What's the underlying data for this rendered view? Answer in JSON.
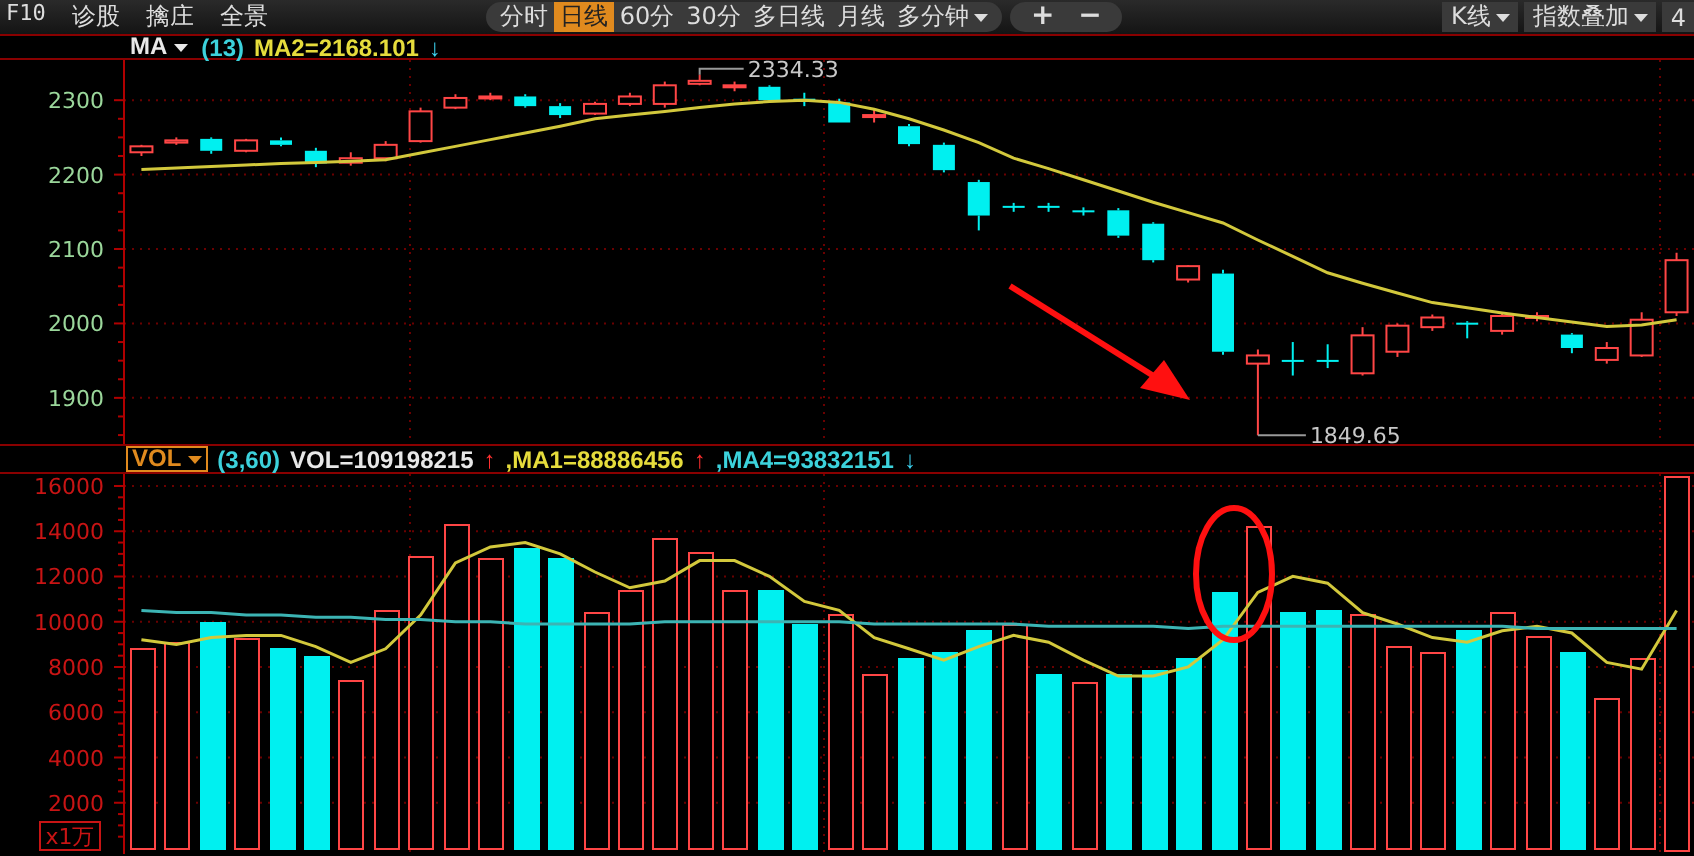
{
  "toolbar": {
    "left_menu": [
      "F10",
      "诊股",
      "擒庄",
      "全景"
    ],
    "period_tabs": [
      {
        "label": "分时",
        "selected": false,
        "dropdown": false
      },
      {
        "label": "日线",
        "selected": true,
        "dropdown": false
      },
      {
        "label": "60分",
        "selected": false,
        "dropdown": false
      },
      {
        "label": "30分",
        "selected": false,
        "dropdown": false
      },
      {
        "label": "多日线",
        "selected": false,
        "dropdown": false
      },
      {
        "label": "月线",
        "selected": false,
        "dropdown": false
      },
      {
        "label": "多分钟",
        "selected": false,
        "dropdown": true
      }
    ],
    "zoom_buttons": [
      "+",
      "−"
    ],
    "right_buttons": [
      {
        "label": "K线",
        "dropdown": true
      },
      {
        "label": "指数叠加",
        "dropdown": true
      },
      {
        "label": "4",
        "dropdown": false
      }
    ]
  },
  "price_panel": {
    "header": {
      "indicator": "MA",
      "items": [
        {
          "kind": "param",
          "text": "(13)"
        },
        {
          "kind": "value",
          "text": "MA2=2168.101",
          "color": "#e6dc3c"
        },
        {
          "kind": "down",
          "text": "↓"
        }
      ]
    },
    "chart_data": {
      "type": "line",
      "ylim": [
        1838,
        2354
      ],
      "yticks": [
        1900,
        2000,
        2100,
        2200,
        2300
      ],
      "grid": true,
      "series": [
        {
          "type": "candlestick",
          "ohlc": [
            [
              2230,
              2240,
              2225,
              2238
            ],
            [
              2243,
              2250,
              2240,
              2246
            ],
            [
              2248,
              2250,
              2228,
              2232
            ],
            [
              2232,
              2248,
              2230,
              2246
            ],
            [
              2246,
              2250,
              2238,
              2240
            ],
            [
              2232,
              2236,
              2210,
              2215
            ],
            [
              2216,
              2230,
              2212,
              2222
            ],
            [
              2222,
              2245,
              2218,
              2240
            ],
            [
              2245,
              2290,
              2243,
              2285
            ],
            [
              2290,
              2308,
              2288,
              2303
            ],
            [
              2303,
              2310,
              2300,
              2305
            ],
            [
              2305,
              2308,
              2290,
              2292
            ],
            [
              2292,
              2296,
              2276,
              2280
            ],
            [
              2282,
              2298,
              2280,
              2295
            ],
            [
              2295,
              2310,
              2292,
              2305
            ],
            [
              2295,
              2325,
              2290,
              2320
            ],
            [
              2322,
              2334.33,
              2320,
              2326
            ],
            [
              2318,
              2325,
              2312,
              2320
            ],
            [
              2318,
              2320,
              2298,
              2300
            ],
            [
              2302,
              2310,
              2292,
              2300
            ],
            [
              2297,
              2302,
              2270,
              2270
            ],
            [
              2278,
              2288,
              2270,
              2280
            ],
            [
              2265,
              2268,
              2238,
              2241
            ],
            [
              2240,
              2243,
              2203,
              2206
            ],
            [
              2190,
              2193,
              2125,
              2145
            ],
            [
              2158,
              2162,
              2150,
              2158
            ],
            [
              2158,
              2162,
              2150,
              2158
            ],
            [
              2152,
              2156,
              2145,
              2152
            ],
            [
              2152,
              2155,
              2115,
              2118
            ],
            [
              2134,
              2136,
              2082,
              2085
            ],
            [
              2059,
              2078,
              2055,
              2077
            ],
            [
              2067,
              2072,
              1958,
              1962
            ],
            [
              1946,
              1965,
              1849.65,
              1957
            ],
            [
              1951,
              1975,
              1930,
              1951
            ],
            [
              1951,
              1972,
              1940,
              1951
            ],
            [
              1933,
              1995,
              1930,
              1984
            ],
            [
              1962,
              2000,
              1955,
              1997
            ],
            [
              1995,
              2012,
              1990,
              2008
            ],
            [
              2001,
              2003,
              1980,
              2000
            ],
            [
              1990,
              2015,
              1985,
              2010
            ],
            [
              2008,
              2015,
              2003,
              2010
            ],
            [
              1985,
              1987,
              1960,
              1967
            ],
            [
              1951,
              1975,
              1946,
              1967
            ],
            [
              1957,
              2015,
              1955,
              2005
            ],
            [
              2015,
              2095,
              2010,
              2085
            ]
          ]
        },
        {
          "type": "line",
          "color": "#d2c83c",
          "values": [
            2207,
            2209,
            2211,
            2213,
            2215,
            2216,
            2218,
            2220,
            2229,
            2238,
            2247,
            2256,
            2265,
            2275,
            2280,
            2285,
            2290,
            2295,
            2298,
            2300,
            2297,
            2288,
            2275,
            2260,
            2243,
            2222,
            2208,
            2193,
            2178,
            2163,
            2149,
            2135,
            2112,
            2090,
            2068,
            2054,
            2041,
            2028,
            2021,
            2014,
            2008,
            2002,
            1996,
            1998,
            2005
          ]
        }
      ],
      "annotations": [
        "2334.33",
        "1849.65"
      ]
    }
  },
  "volume_panel": {
    "header": {
      "indicator": "VOL",
      "items": [
        {
          "kind": "param",
          "text": "(3,60)"
        },
        {
          "kind": "value",
          "text": "VOL=109198215",
          "color": "#e8e8e8"
        },
        {
          "kind": "up",
          "text": "↑"
        },
        {
          "kind": "value",
          "text": ",MA1=88886456",
          "color": "#e6dc3c"
        },
        {
          "kind": "up",
          "text": "↑"
        },
        {
          "kind": "value",
          "text": ",MA4=93832151",
          "color": "#3cd2dc"
        },
        {
          "kind": "down",
          "text": "↓"
        }
      ]
    },
    "chart_data": {
      "type": "bar",
      "ylim": [
        -265,
        16530
      ],
      "yticks": [
        2000,
        4000,
        6000,
        8000,
        10000,
        12000,
        14000,
        16000
      ],
      "ylabel": "x1万",
      "grid": true,
      "series": [
        {
          "type": "bar",
          "colors": [
            "#ff4646",
            "#ff4646",
            "#00f0f0",
            "#ff4646",
            "#00f0f0",
            "#00f0f0",
            "#ff4646",
            "#ff4646",
            "#ff4646",
            "#ff4646",
            "#ff4646",
            "#00f0f0",
            "#00f0f0",
            "#ff4646",
            "#ff4646",
            "#ff4646",
            "#ff4646",
            "#ff4646",
            "#00f0f0",
            "#00f0f0",
            "#ff4646",
            "#ff4646",
            "#00f0f0",
            "#00f0f0",
            "#00f0f0",
            "#ff4646",
            "#00f0f0",
            "#ff4646",
            "#00f0f0",
            "#00f0f0",
            "#00f0f0",
            "#00f0f0",
            "#ff4646",
            "#00f0f0",
            "#00f0f0",
            "#ff4646",
            "#ff4646",
            "#ff4646",
            "#00f0f0",
            "#ff4646",
            "#ff4646",
            "#00f0f0",
            "#ff4646",
            "#ff4646",
            "#ff4646"
          ],
          "values": [
            8800,
            9100,
            10000,
            9300,
            8800,
            8500,
            7400,
            10500,
            12900,
            14300,
            12800,
            13300,
            12800,
            10400,
            11400,
            13700,
            13100,
            11400,
            11400,
            9900,
            10300,
            7700,
            8400,
            8700,
            9600,
            9900,
            7700,
            7300,
            7700,
            7900,
            8400,
            11300,
            14200,
            10400,
            10500,
            10300,
            8900,
            8700,
            9600,
            10400,
            9400,
            8700,
            6600,
            8400,
            16500
          ]
        },
        {
          "type": "line",
          "color": "#d2c83c",
          "values": [
            9200,
            9000,
            9300,
            9400,
            9400,
            8900,
            8200,
            8800,
            10300,
            12600,
            13300,
            13500,
            13000,
            12200,
            11500,
            11800,
            12700,
            12700,
            12000,
            10900,
            10500,
            9300,
            8800,
            8300,
            8900,
            9400,
            9100,
            8300,
            7600,
            7600,
            8000,
            9200,
            11300,
            12000,
            11700,
            10400,
            9900,
            9300,
            9100,
            9600,
            9800,
            9500,
            8200,
            7900,
            10500
          ]
        },
        {
          "type": "line",
          "color": "#3cb4b4",
          "values": [
            10500,
            10400,
            10400,
            10300,
            10300,
            10200,
            10200,
            10100,
            10100,
            10000,
            10000,
            9900,
            9900,
            9900,
            9900,
            10000,
            10000,
            10000,
            10000,
            10000,
            10000,
            9900,
            9900,
            9900,
            9900,
            9900,
            9800,
            9800,
            9800,
            9800,
            9700,
            9800,
            9800,
            9800,
            9800,
            9800,
            9800,
            9800,
            9800,
            9800,
            9700,
            9700,
            9700,
            9700,
            9700
          ]
        }
      ]
    }
  }
}
